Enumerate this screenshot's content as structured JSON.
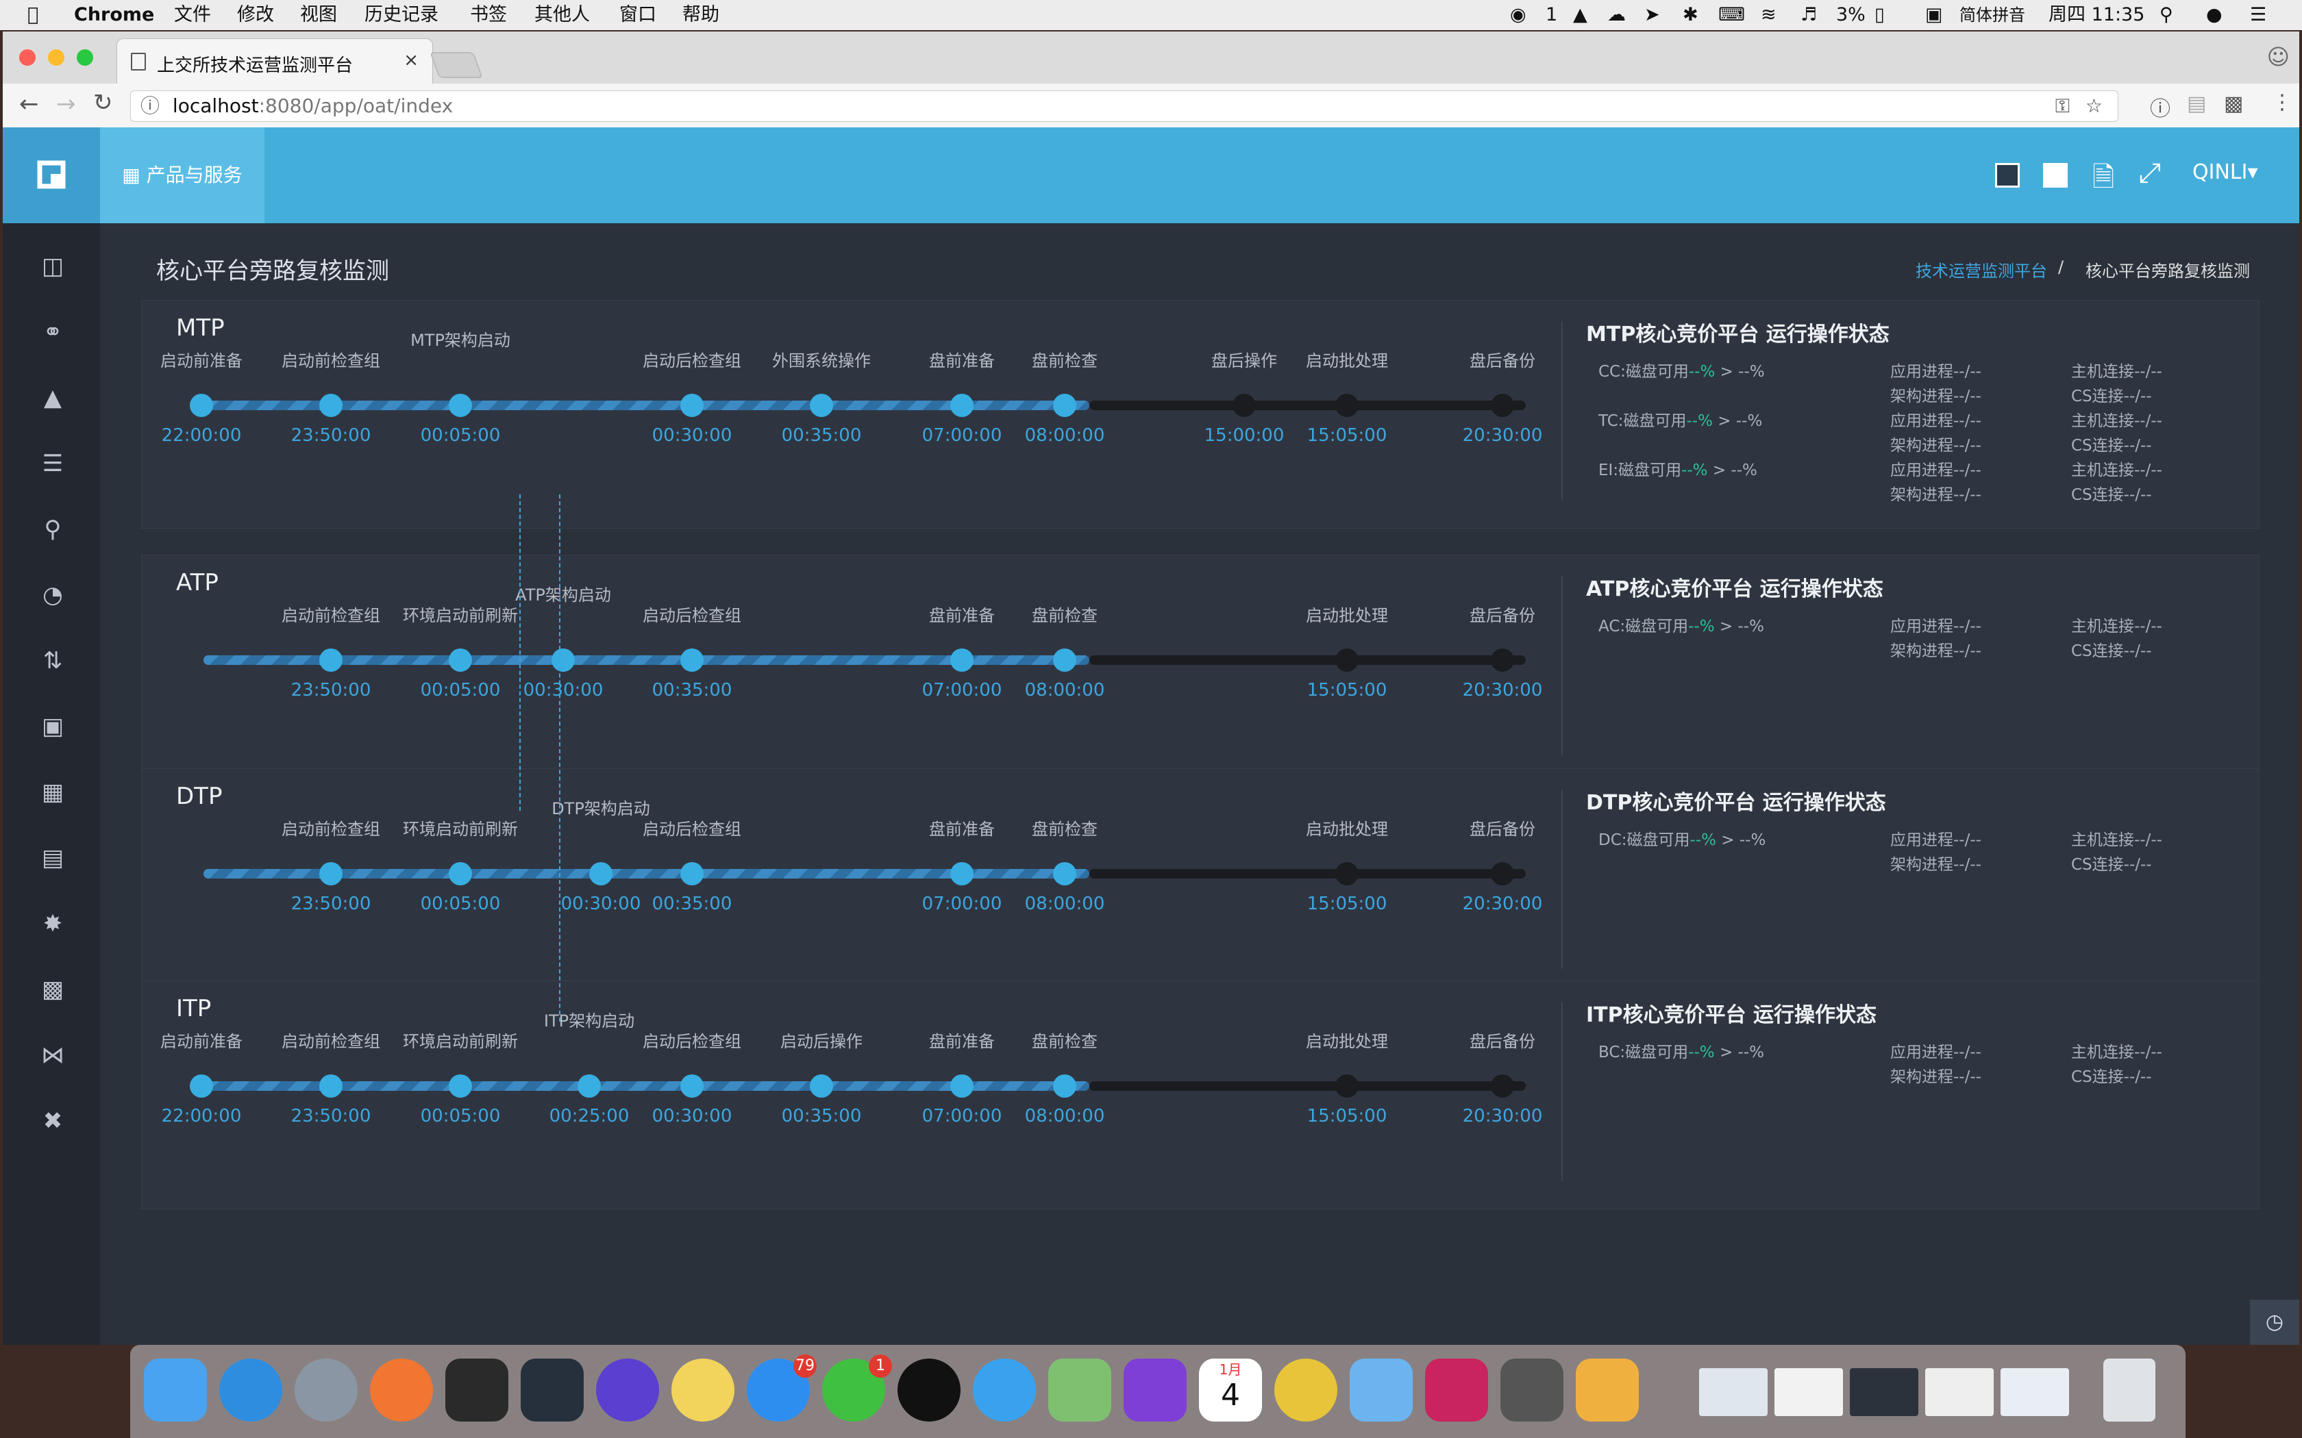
{
  "menubar": {
    "app": "Chrome",
    "items": [
      "文件",
      "修改",
      "视图",
      "历史记录",
      "书签",
      "其他人",
      "窗口",
      "帮助"
    ],
    "right": {
      "msg_count": "1",
      "battery": "3%",
      "input_method": "简体拼音",
      "clock": "周四 11:35"
    }
  },
  "browser": {
    "tab_title": "上交所技术运营监测平台",
    "url_host": "localhost",
    "url_rest": ":8080/app/oat/index"
  },
  "header": {
    "products": "产品与服务",
    "user": "QINLI"
  },
  "page": {
    "title": "核心平台旁路复核监测",
    "crumb_link": "技术运营监测平台",
    "crumb_sep": "/",
    "crumb_current": "核心平台旁路复核监测"
  },
  "panels": [
    {
      "name": "MTP",
      "status_title": "MTP核心竞价平台 运行操作状态",
      "progress": 0.67,
      "nodes": [
        {
          "label": "启动前准备",
          "time": "22:00:00",
          "done": true
        },
        {
          "label": "启动前检查组",
          "time": "23:50:00",
          "done": true
        },
        {
          "label": "MTP架构启动",
          "time": "00:05:00",
          "done": true,
          "high": true
        },
        {
          "label": "启动后检查组",
          "time": "00:30:00",
          "done": true
        },
        {
          "label": "外围系统操作",
          "time": "00:35:00",
          "done": true
        },
        {
          "label": "盘前准备",
          "time": "07:00:00",
          "done": true
        },
        {
          "label": "盘前检查",
          "time": "08:00:00",
          "done": true
        },
        {
          "label": "盘后操作",
          "time": "15:00:00",
          "done": false
        },
        {
          "label": "启动批处理",
          "time": "15:05:00",
          "done": false
        },
        {
          "label": "盘后备份",
          "time": "20:30:00",
          "done": false
        }
      ],
      "status": [
        {
          "disk": "CC:磁盘可用",
          "val": "--%",
          "tail": " > --%",
          "proc": "应用进程--/--",
          "arch": "架构进程--/--",
          "host": "主机连接--/--",
          "cs": "CS连接--/--"
        },
        {
          "disk": "TC:磁盘可用",
          "val": "--%",
          "tail": " > --%",
          "proc": "应用进程--/--",
          "arch": "架构进程--/--",
          "host": "主机连接--/--",
          "cs": "CS连接--/--"
        },
        {
          "disk": "EI:磁盘可用",
          "val": "--%",
          "tail": " > --%",
          "proc": "应用进程--/--",
          "arch": "架构进程--/--",
          "host": "主机连接--/--",
          "cs": "CS连接--/--"
        }
      ]
    },
    {
      "name": "ATP",
      "status_title": "ATP核心竞价平台 运行操作状态",
      "progress": 0.67,
      "nodes": [
        {
          "label": "启动前检查组",
          "time": "23:50:00",
          "done": true
        },
        {
          "label": "环境启动前刷新",
          "time": "00:05:00",
          "done": true
        },
        {
          "label": "ATP架构启动",
          "time": "00:30:00",
          "done": true,
          "high": true
        },
        {
          "label": "启动后检查组",
          "time": "00:35:00",
          "done": true
        },
        {
          "label": "盘前准备",
          "time": "07:00:00",
          "done": true
        },
        {
          "label": "盘前检查",
          "time": "08:00:00",
          "done": true
        },
        {
          "label": "启动批处理",
          "time": "15:05:00",
          "done": false
        },
        {
          "label": "盘后备份",
          "time": "20:30:00",
          "done": false
        }
      ],
      "status": [
        {
          "disk": "AC:磁盘可用",
          "val": "--%",
          "tail": " > --%",
          "proc": "应用进程--/--",
          "arch": "架构进程--/--",
          "host": "主机连接--/--",
          "cs": "CS连接--/--"
        }
      ]
    },
    {
      "name": "DTP",
      "status_title": "DTP核心竞价平台 运行操作状态",
      "progress": 0.67,
      "nodes": [
        {
          "label": "启动前检查组",
          "time": "23:50:00",
          "done": true
        },
        {
          "label": "环境启动前刷新",
          "time": "00:05:00",
          "done": true
        },
        {
          "label": "DTP架构启动",
          "time": "00:30:00",
          "done": true,
          "high": true
        },
        {
          "label": "启动后检查组",
          "time": "00:35:00",
          "done": true
        },
        {
          "label": "盘前准备",
          "time": "07:00:00",
          "done": true
        },
        {
          "label": "盘前检查",
          "time": "08:00:00",
          "done": true
        },
        {
          "label": "启动批处理",
          "time": "15:05:00",
          "done": false
        },
        {
          "label": "盘后备份",
          "time": "20:30:00",
          "done": false
        }
      ],
      "status": [
        {
          "disk": "DC:磁盘可用",
          "val": "--%",
          "tail": " > --%",
          "proc": "应用进程--/--",
          "arch": "架构进程--/--",
          "host": "主机连接--/--",
          "cs": "CS连接--/--"
        }
      ]
    },
    {
      "name": "ITP",
      "status_title": "ITP核心竞价平台 运行操作状态",
      "progress": 0.67,
      "nodes": [
        {
          "label": "启动前准备",
          "time": "22:00:00",
          "done": true
        },
        {
          "label": "启动前检查组",
          "time": "23:50:00",
          "done": true
        },
        {
          "label": "环境启动前刷新",
          "time": "00:05:00",
          "done": true
        },
        {
          "label": "ITP架构启动",
          "time": "00:25:00",
          "done": true,
          "high": true
        },
        {
          "label": "启动后检查组",
          "time": "00:30:00",
          "done": true
        },
        {
          "label": "启动后操作",
          "time": "00:35:00",
          "done": true
        },
        {
          "label": "盘前准备",
          "time": "07:00:00",
          "done": true
        },
        {
          "label": "盘前检查",
          "time": "08:00:00",
          "done": true
        },
        {
          "label": "启动批处理",
          "time": "15:05:00",
          "done": false
        },
        {
          "label": "盘后备份",
          "time": "20:30:00",
          "done": false
        }
      ],
      "status": [
        {
          "disk": "BC:磁盘可用",
          "val": "--%",
          "tail": " > --%",
          "proc": "应用进程--/--",
          "arch": "架构进程--/--",
          "host": "主机连接--/--",
          "cs": "CS连接--/--"
        }
      ]
    }
  ],
  "dock": {
    "appstore_badge": "79",
    "wechat_badge": "1",
    "calendar_month": "1月",
    "calendar_day": "4"
  },
  "colors": {
    "accent": "#44aedb",
    "done": "#38aee2",
    "pending": "#1a1c20",
    "ok_green": "#2bbf95",
    "bg": "#2b313b"
  }
}
